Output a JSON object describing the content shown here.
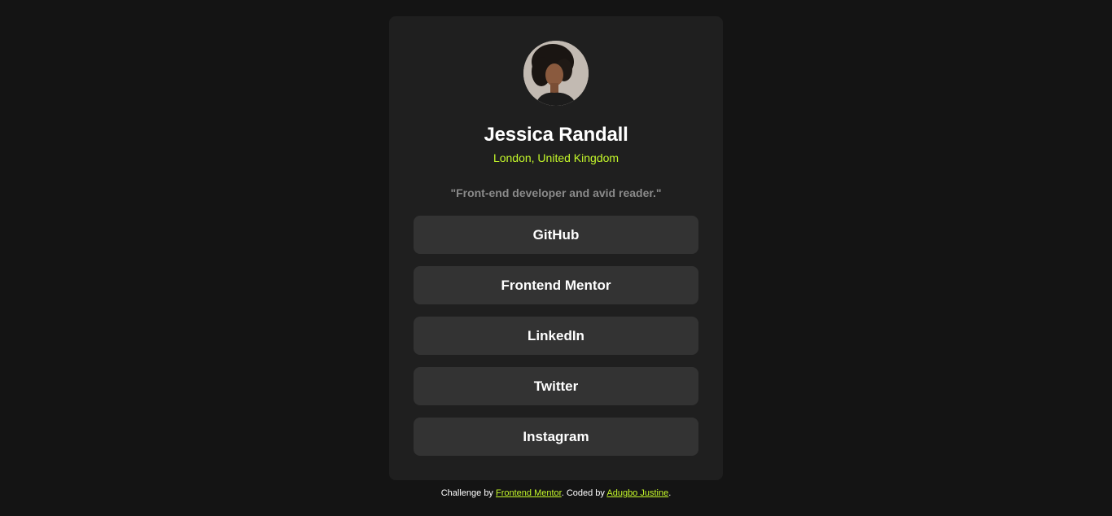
{
  "profile": {
    "avatar_alt": "Jessica Randall",
    "name": "Jessica Randall",
    "location": "London, United Kingdom",
    "bio": "\"Front-end developer and avid reader.\""
  },
  "links": [
    {
      "label": "GitHub"
    },
    {
      "label": "Frontend Mentor"
    },
    {
      "label": "LinkedIn"
    },
    {
      "label": "Twitter"
    },
    {
      "label": "Instagram"
    }
  ],
  "footer": {
    "prefix": "Challenge by",
    "challenge_link": "Frontend Mentor",
    "middle": ". Coded by",
    "author_link": "Adugbo Justine",
    "suffix": "."
  },
  "colors": {
    "page_background": "#141414",
    "card_background": "#1f1f1f",
    "button_background": "#333333",
    "accent": "#c4f82a",
    "text": "#ffffff",
    "muted": "#8a8a8a"
  }
}
